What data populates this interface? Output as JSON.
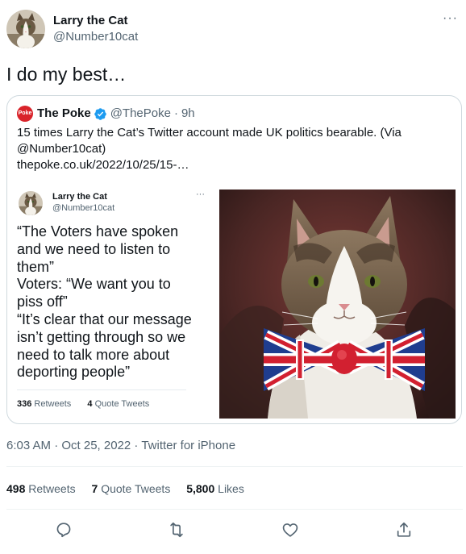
{
  "author": {
    "display_name": "Larry the Cat",
    "handle": "@Number10cat"
  },
  "icons": {
    "more": "more-horizontal-icon",
    "verified": "verified-badge-icon",
    "reply": "reply-icon",
    "retweet": "retweet-icon",
    "like": "like-icon",
    "share": "share-icon"
  },
  "tweet": {
    "text": "I do my best…",
    "timestamp": "6:03 AM · Oct 25, 2022 · Twitter for iPhone"
  },
  "quoted_tweet": {
    "logo_text": "Poke",
    "name": "The Poke",
    "handle": "@ThePoke",
    "dot": "·",
    "time": "9h",
    "body": "15 times Larry the Cat’s Twitter account made UK politics bearable. (Via @Number10cat)",
    "link": "thepoke.co.uk/2022/10/25/15-…",
    "embedded_tweet": {
      "name": "Larry the Cat",
      "handle": "@Number10cat",
      "more": "···",
      "lines": [
        "“The Voters have spoken",
        "and we need to listen to",
        "them”",
        "Voters: “We want you to",
        "piss off”",
        "“It’s clear that our message",
        "isn’t getting through so we",
        "need to talk more about",
        "deporting people”"
      ],
      "retweets_count": "336",
      "retweets_label": "Retweets",
      "quotes_count": "4",
      "quotes_label": "Quote Tweets"
    }
  },
  "stats": {
    "retweets_count": "498",
    "retweets_label": "Retweets",
    "quotes_count": "7",
    "quotes_label": "Quote Tweets",
    "likes_count": "5,800",
    "likes_label": "Likes"
  },
  "colors": {
    "text": "#0f1419",
    "secondary": "#536471",
    "border": "#cfd9de",
    "verified": "#1d9bf0",
    "poke_red": "#d9232a"
  }
}
